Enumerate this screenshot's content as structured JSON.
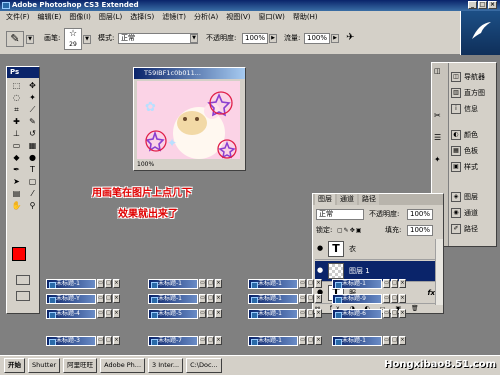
{
  "window": {
    "title": "Adobe Photoshop CS3 Extended",
    "controls": [
      "_",
      "□",
      "×"
    ]
  },
  "menu": {
    "items": [
      "文件(F)",
      "编辑(E)",
      "图像(I)",
      "图层(L)",
      "选择(S)",
      "滤镜(T)",
      "分析(A)",
      "视图(V)",
      "窗口(W)",
      "帮助(H)"
    ]
  },
  "options": {
    "brush_label": "画笔:",
    "brush_size": "29",
    "mode_label": "模式:",
    "mode_value": "正常",
    "opacity_label": "不透明度:",
    "opacity_value": "100%",
    "flow_label": "流量:",
    "flow_value": "100%"
  },
  "toolbox": {
    "header": "Ps"
  },
  "document": {
    "title": "T59IBF1c0b011...",
    "zoom": "100%"
  },
  "annotation": {
    "line1": "用画笔在图片上点几下",
    "line2": "效果就出来了"
  },
  "right_dock": {
    "items": [
      "导航器",
      "直方图",
      "信息",
      "颜色",
      "色板",
      "样式",
      "图层",
      "通道",
      "路径"
    ]
  },
  "layers_panel": {
    "tabs": [
      "图层",
      "通道",
      "路径"
    ],
    "blend_mode": "正常",
    "opacity_label": "不透明度:",
    "opacity_value": "100%",
    "lock_label": "锁定:",
    "fill_label": "填充:",
    "fill_value": "100%",
    "layers": [
      {
        "name": "衣",
        "type": "text"
      },
      {
        "name": "图层 1",
        "type": "raster"
      },
      {
        "name": "服",
        "type": "text"
      }
    ]
  },
  "minimized": [
    "未标题-1",
    "未标题-1",
    "未标题-1",
    "未标题-1",
    "未标题-Y",
    "未标题-1",
    "未标题-1",
    "未标题-9",
    "未标题-4",
    "未标题-5",
    "未标题-1",
    "未标题-6",
    "未标题-3",
    "未标题-7",
    "未标题-1",
    "未标题-1"
  ],
  "taskbar": {
    "items": [
      "开始",
      "Shutter",
      "阿里旺旺",
      "Adobe Ph...",
      "3 Inter...",
      "C:\\Doc..."
    ]
  },
  "watermark": "Hongxibao8.51.com"
}
